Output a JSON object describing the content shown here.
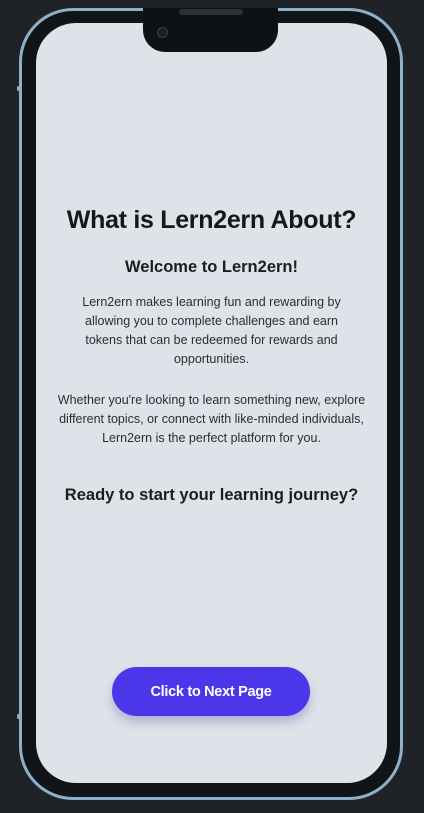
{
  "page": {
    "title": "What is Lern2ern About?",
    "welcome": "Welcome to Lern2ern!",
    "paragraph_1": "Lern2ern makes learning fun and rewarding by allowing you to complete challenges and earn tokens that can be redeemed for rewards and opportunities.",
    "paragraph_2": "Whether you're looking to learn something new, explore different topics, or connect with like-minded individuals, Lern2ern is the perfect platform for you.",
    "call_to_action": "Ready to start your learning journey?",
    "next_button_label": "Click to Next Page"
  },
  "colors": {
    "screen_background": "#dfe2e8",
    "button_background": "#4b36ea",
    "frame_outline": "#8fb0c9"
  }
}
